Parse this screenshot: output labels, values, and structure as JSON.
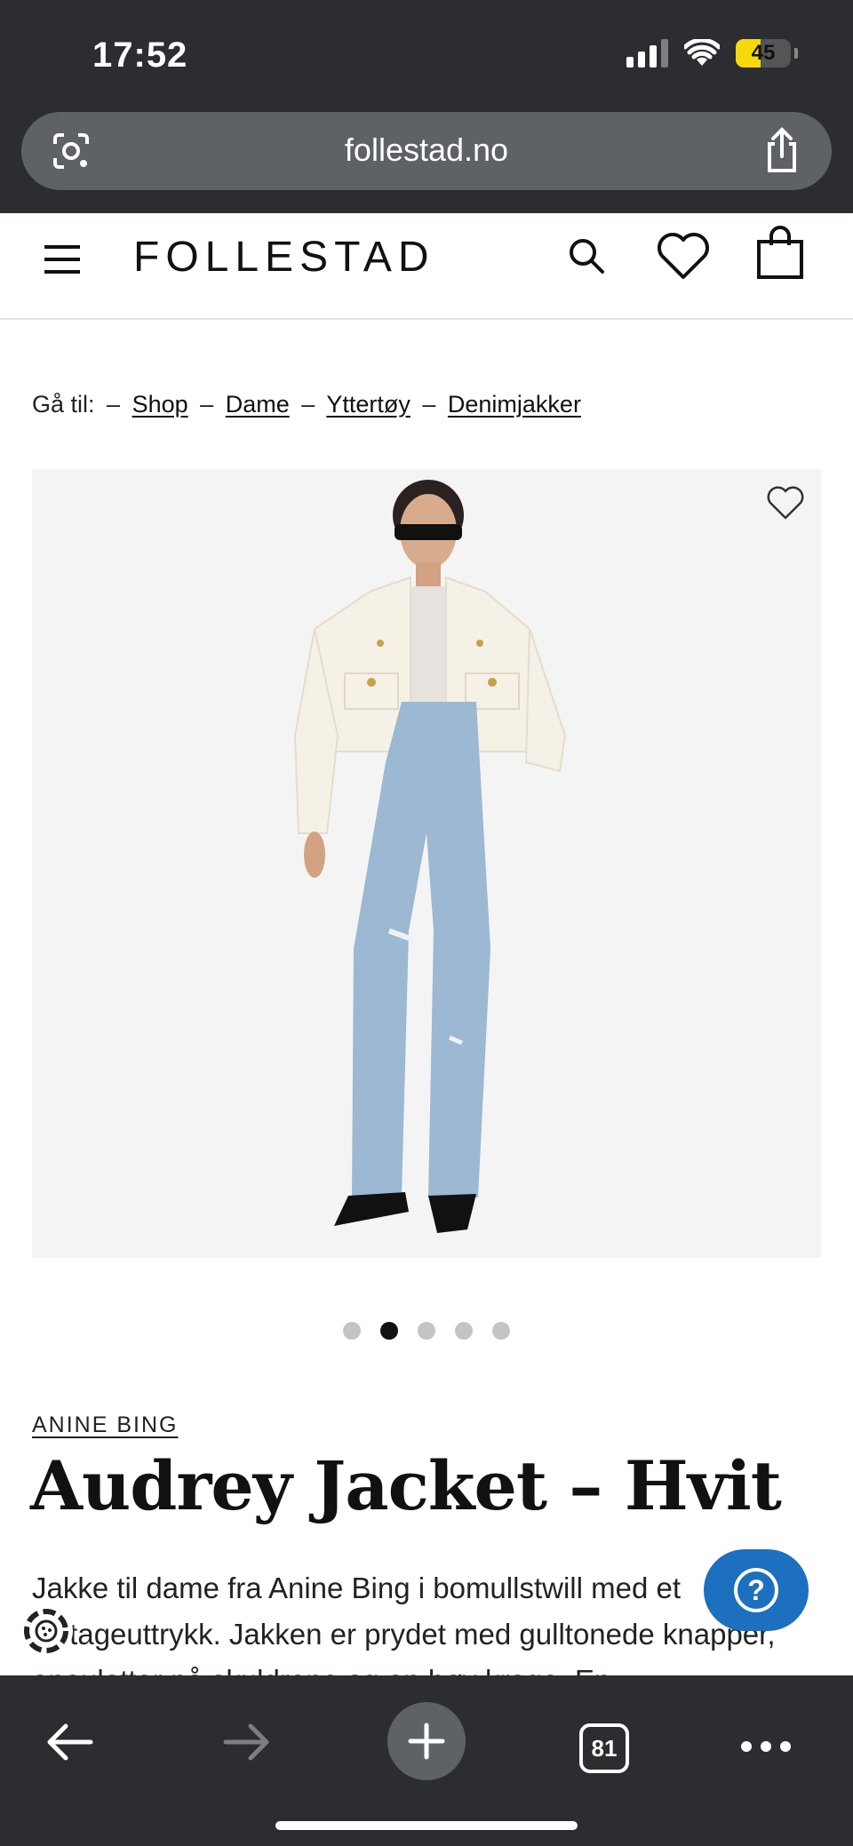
{
  "status_bar": {
    "time": "17:52",
    "battery": "45",
    "battery_fill_fraction": 0.45
  },
  "browser": {
    "url": "follestad.no",
    "tab_count": "81"
  },
  "header": {
    "logo": "FOLLESTAD"
  },
  "breadcrumb": {
    "prefix": "Gå til:",
    "separator": "–",
    "items": [
      "Shop",
      "Dame",
      "Yttertøy",
      "Denimjakker"
    ]
  },
  "gallery": {
    "slide_count": 5,
    "active_slide": 2
  },
  "product": {
    "brand": "ANINE BING",
    "title": "Audrey Jacket – Hvit",
    "description": "Jakke til dame fra Anine Bing i bomullstwill med et vintageuttrykk. Jakken er prydet med gulltonede knapper, epauletter på skuldrene og en høy krage. En"
  },
  "colors": {
    "chrome": "#2b2d30",
    "help_button": "#1d6fbf",
    "battery": "#f5d90a"
  }
}
